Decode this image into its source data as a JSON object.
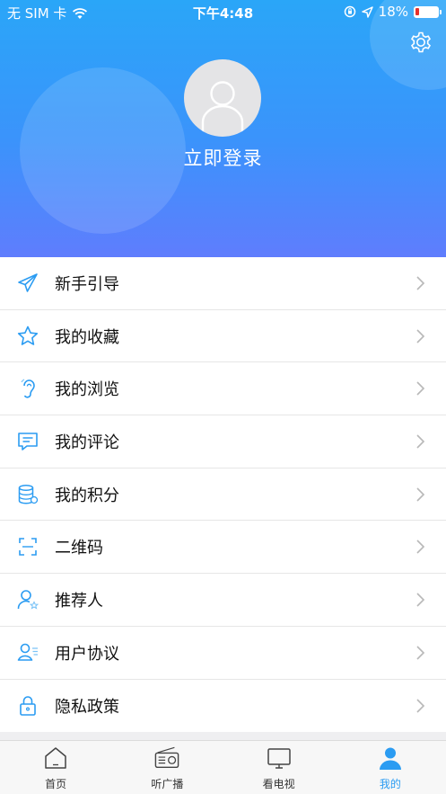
{
  "status_bar": {
    "carrier": "无 SIM 卡",
    "time": "下午4:48",
    "battery_percent": "18%",
    "battery_level": 0.18
  },
  "profile": {
    "login_label": "立即登录"
  },
  "menu": {
    "items": [
      {
        "label": "新手引导",
        "icon": "paper-plane-icon"
      },
      {
        "label": "我的收藏",
        "icon": "star-icon"
      },
      {
        "label": "我的浏览",
        "icon": "ear-icon"
      },
      {
        "label": "我的评论",
        "icon": "comment-icon"
      },
      {
        "label": "我的积分",
        "icon": "coins-icon"
      },
      {
        "label": "二维码",
        "icon": "scan-icon"
      },
      {
        "label": "推荐人",
        "icon": "user-star-icon"
      },
      {
        "label": "用户协议",
        "icon": "user-agreement-icon"
      },
      {
        "label": "隐私政策",
        "icon": "lock-icon"
      }
    ]
  },
  "tabbar": {
    "tabs": [
      {
        "label": "首页",
        "icon": "home-icon",
        "active": false
      },
      {
        "label": "听广播",
        "icon": "radio-icon",
        "active": false
      },
      {
        "label": "看电视",
        "icon": "tv-icon",
        "active": false
      },
      {
        "label": "我的",
        "icon": "profile-icon",
        "active": true
      }
    ]
  },
  "colors": {
    "accent": "#2b9cf2",
    "header_top": "#2aa6f8",
    "header_bottom": "#5f7dfd",
    "battery_low": "#e8302b"
  }
}
